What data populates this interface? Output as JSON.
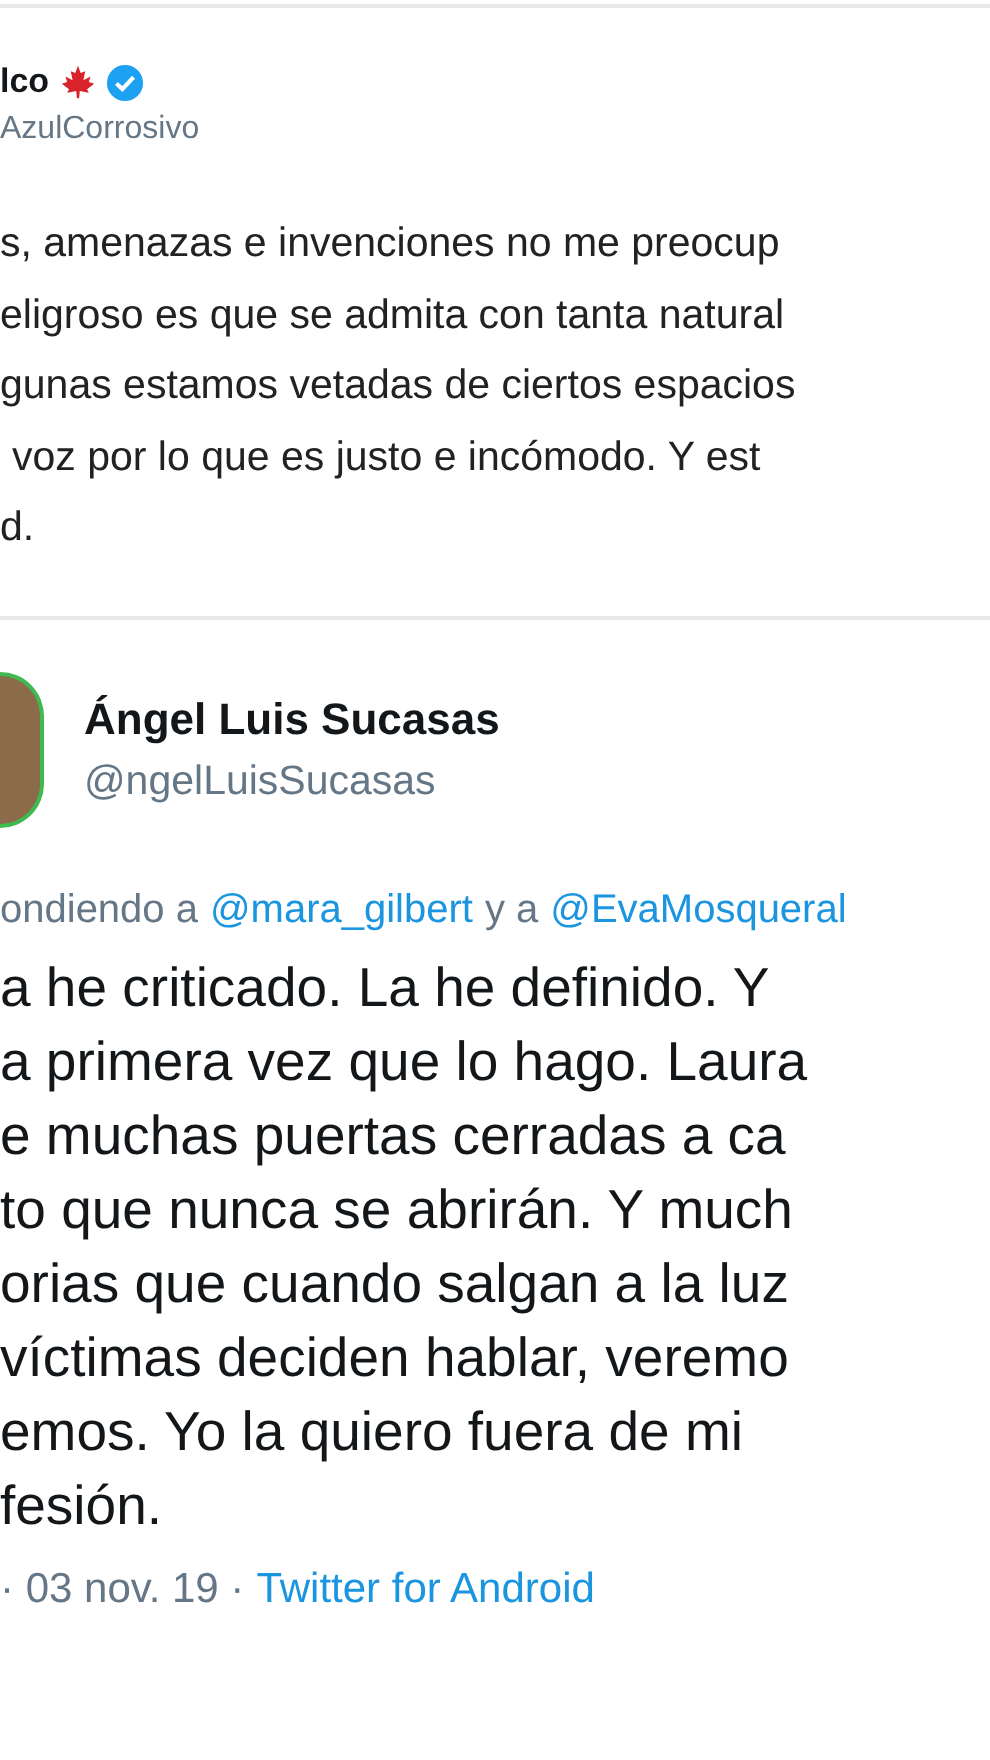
{
  "quoted_tweet": {
    "author_name": "lco",
    "handle": "AzulCorrosivo",
    "verified": true,
    "lines": [
      "s, amenazas e invenciones no me preocup",
      "eligroso es que se admita con tanta natural",
      "gunas estamos vetadas de ciertos espacios",
      "voz por lo que es justo e incómodo. Y est",
      "d."
    ]
  },
  "tweet": {
    "author_name": "Ángel Luis Sucasas",
    "handle": "@ngelLuisSucasas",
    "reply_to": [
      {
        "kind": "text",
        "text": "ondiendo a"
      },
      {
        "kind": "mention",
        "text": "@mara_gilbert"
      },
      {
        "kind": "text",
        "text": "y a"
      },
      {
        "kind": "mention",
        "text": "@EvaMosqueral"
      }
    ],
    "lines": [
      "a he criticado. La he definido.  Y",
      "a primera vez que lo hago. Laura",
      "e muchas puertas cerradas a ca",
      "to que nunca se abrirán. Y much",
      "orias que cuando salgan a la luz",
      "víctimas deciden hablar, veremo",
      "emos. Yo la quiero fuera de mi",
      "fesión."
    ],
    "date": "· 03 nov. 19 ·",
    "source": "Twitter for Android"
  }
}
